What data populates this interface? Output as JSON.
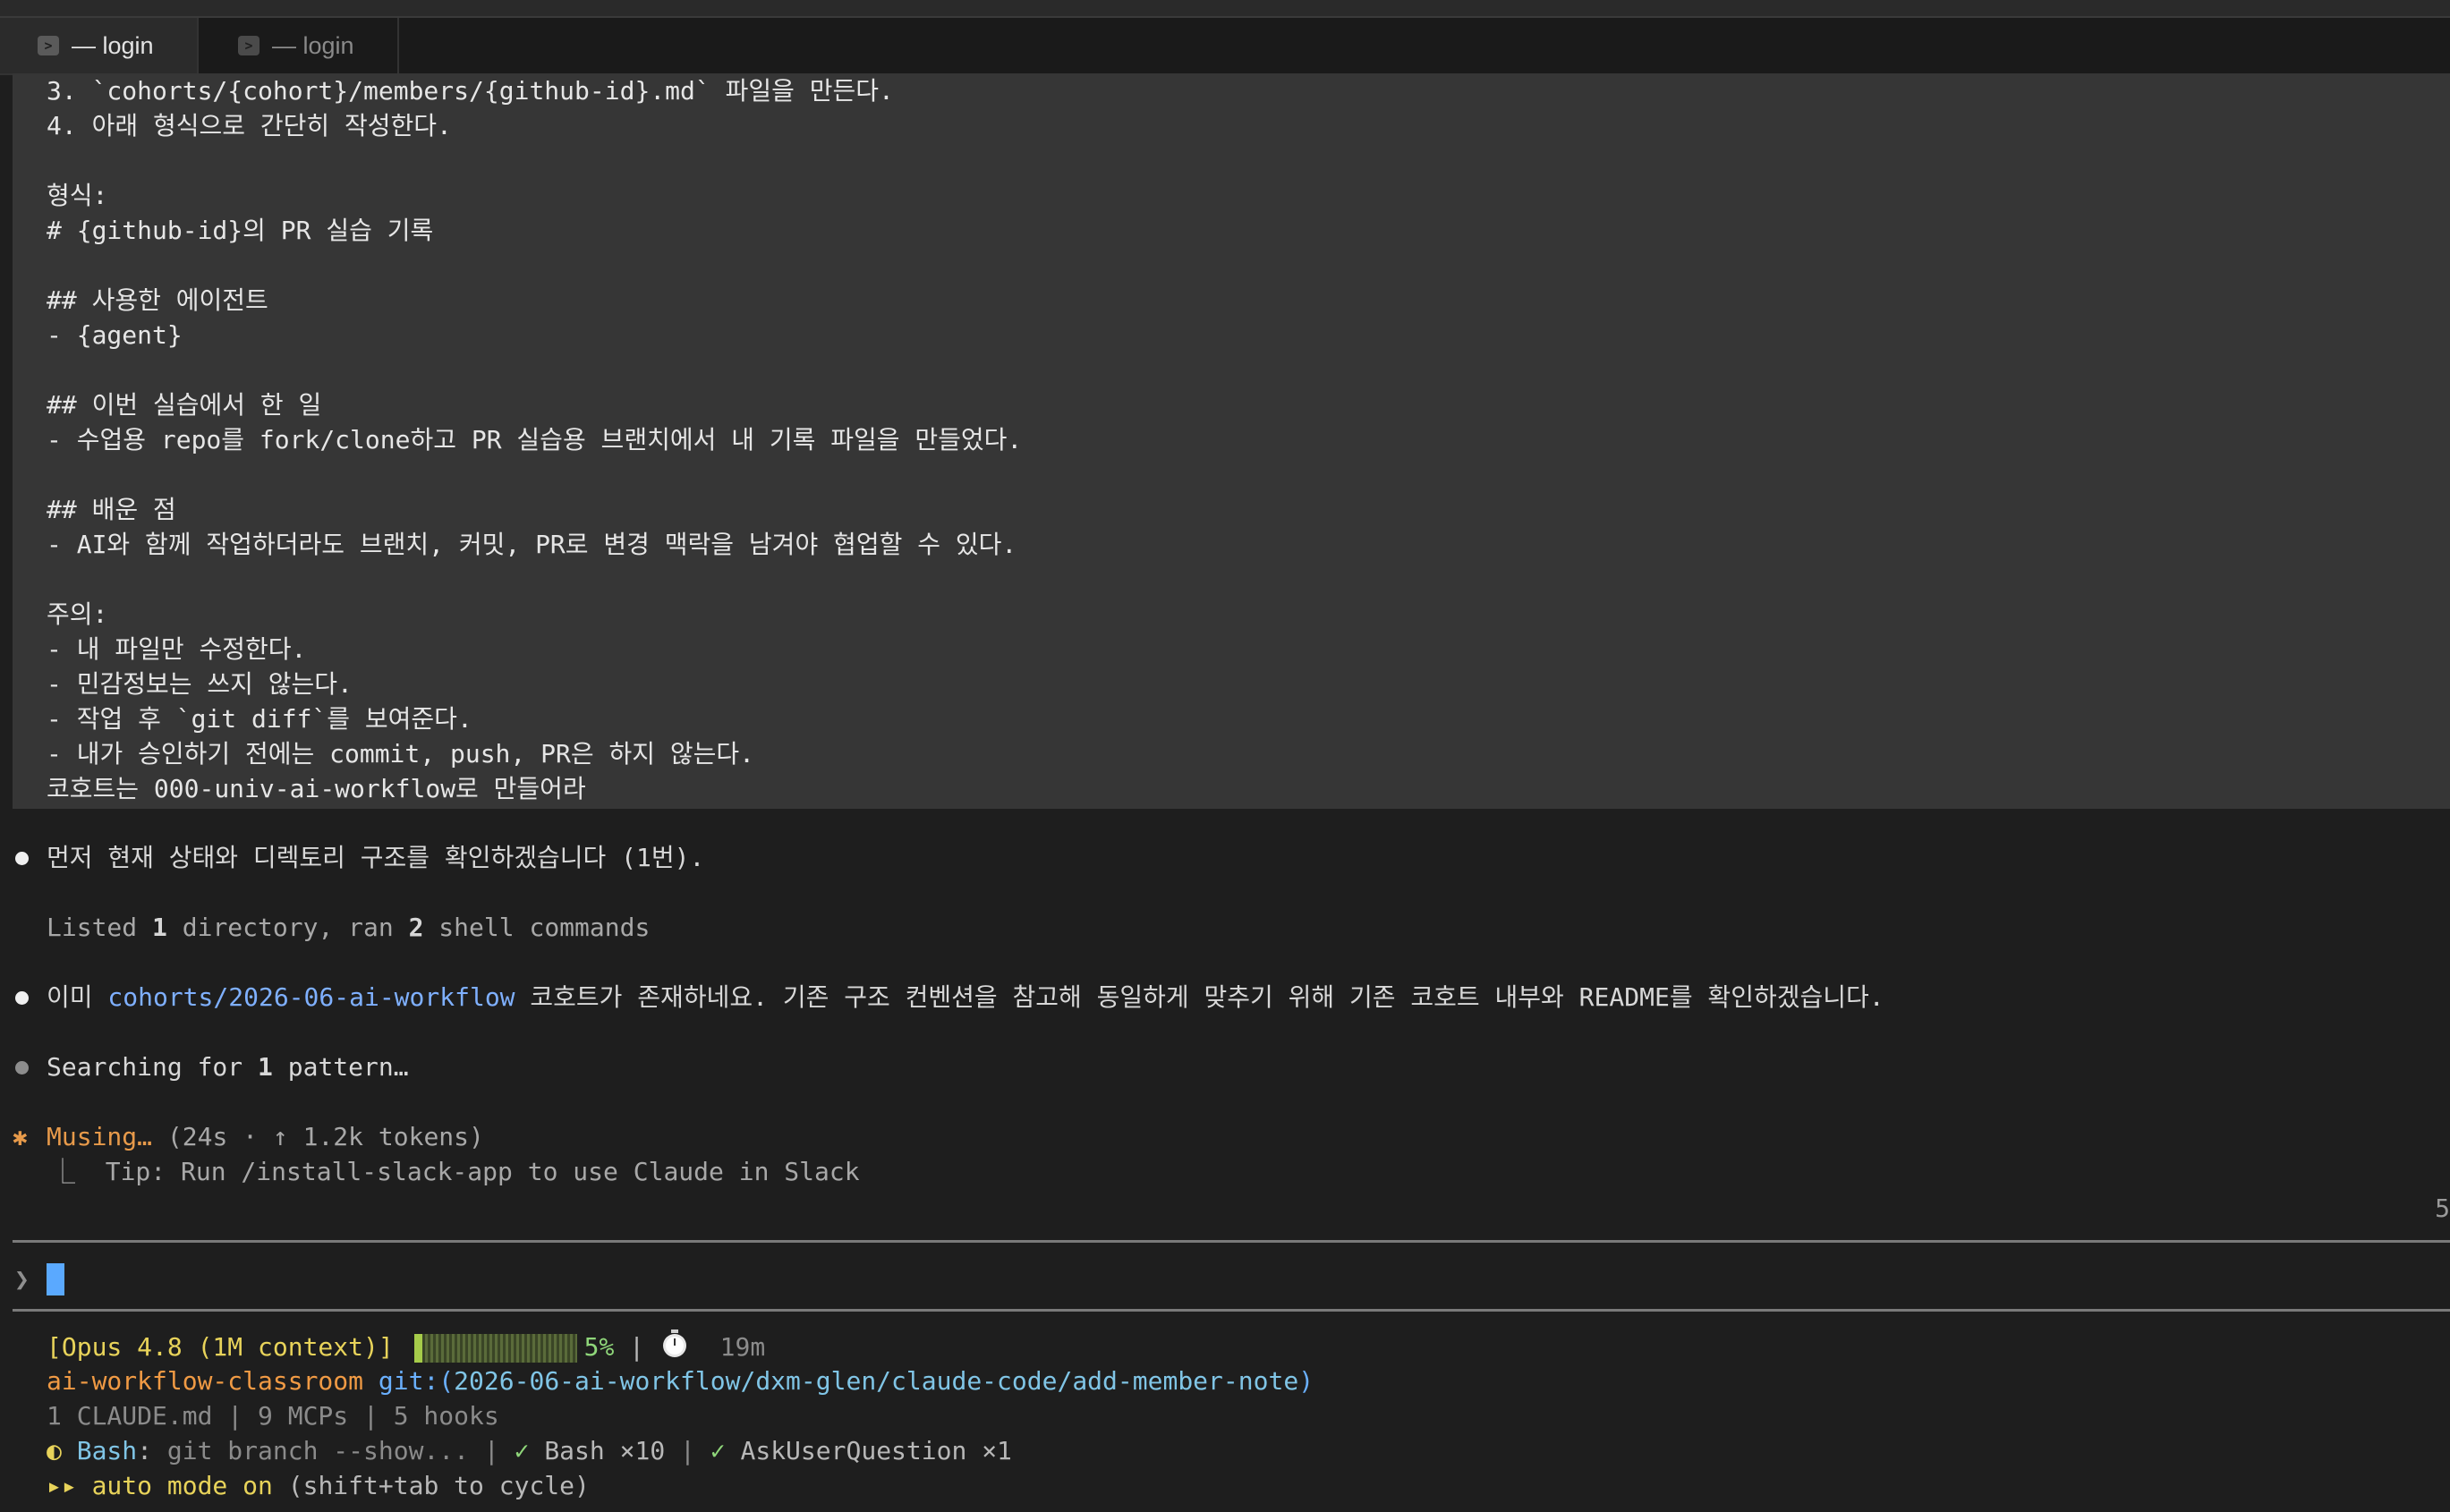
{
  "tabs": [
    {
      "label": "— login",
      "icon": "terminal-icon",
      "active": true
    },
    {
      "label": "— login",
      "icon": "terminal-icon",
      "active": false
    }
  ],
  "prompt_lines": [
    "3. `cohorts/{cohort}/members/{github-id}.md` 파일을 만든다.",
    "4. 아래 형식으로 간단히 작성한다.",
    "",
    "형식:",
    "# {github-id}의 PR 실습 기록",
    "",
    "## 사용한 에이전트",
    "- {agent}",
    "",
    "## 이번 실습에서 한 일",
    "- 수업용 repo를 fork/clone하고 PR 실습용 브랜치에서 내 기록 파일을 만들었다.",
    "",
    "## 배운 점",
    "- AI와 함께 작업하더라도 브랜치, 커밋, PR로 변경 맥락을 남겨야 협업할 수 있다.",
    "",
    "주의:",
    "- 내 파일만 수정한다.",
    "- 민감정보는 쓰지 않는다.",
    "- 작업 후 `git diff`를 보여준다.",
    "- 내가 승인하기 전에는 commit, push, PR은 하지 않는다.",
    "코호트는 000-univ-ai-workflow로 만들어라"
  ],
  "transcript": {
    "msg1": "먼저 현재 상태와 디렉토리 구조를 확인하겠습니다 (1번).",
    "tool1": {
      "pre": "Listed ",
      "n1": "1",
      "mid": " directory, ran ",
      "n2": "2",
      "post": " shell commands"
    },
    "msg2": {
      "pre": "이미 ",
      "path": "cohorts/2026-06-ai-workflow",
      "post": " 코호트가 존재하네요. 기존 구조 컨벤션을 참고해 동일하게 맞추기 위해 기존 코호트 내부와 README를 확인하겠습니다."
    },
    "tool2": {
      "pre": "Searching for ",
      "n": "1",
      "post": " pattern…"
    },
    "spinner": {
      "star": "✱",
      "word": "Musing…",
      "meta": "(24s · ↑ 1.2k tokens)"
    },
    "tip": "⎿  Tip: Run /install-slack-app to use Claude in Slack",
    "right_num": "5"
  },
  "input": {
    "caret": "❯",
    "value": ""
  },
  "status": {
    "model": "[Opus 4.8 (1M context)]",
    "context_percent": 5,
    "context_percent_label": "5%",
    "separator": "|",
    "elapsed": "19m",
    "repo": "ai-workflow-classroom",
    "git_prefix": "git:(",
    "branch": "2026-06-ai-workflow/dxm-glen/claude-code/add-member-note",
    "git_suffix": ")",
    "config": "1 CLAUDE.md | 9 MCPs | 5 hooks",
    "activity": {
      "spinner_glyph": "◐",
      "tool": "Bash",
      "colon": ":",
      "detail": " git branch --show...",
      "sep1": " | ",
      "check1": "✓",
      "item1": " Bash ×10",
      "sep2": " | ",
      "check2": "✓",
      "item2": " AskUserQuestion ×1"
    },
    "mode": {
      "arrows": "▸▸",
      "label": " auto mode on",
      "hint": " (shift+tab to cycle)"
    }
  },
  "colors": {
    "background": "#1e1e1e",
    "prompt_block": "#363636",
    "accent_orange": "#e79a4a",
    "link_blue": "#7fb0ff",
    "status_yellow": "#e8d35a",
    "cursor": "#5aa9ff"
  }
}
